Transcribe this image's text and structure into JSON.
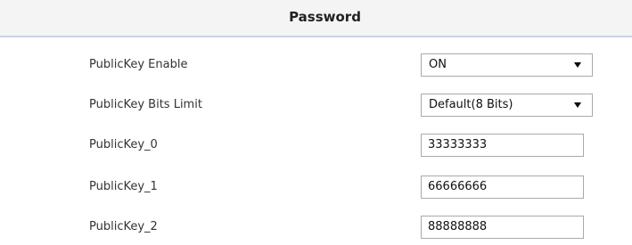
{
  "section": {
    "title": "Password"
  },
  "fields": {
    "publickey_enable": {
      "label": "PublicKey Enable",
      "value": "ON"
    },
    "publickey_bits_limit": {
      "label": "PublicKey Bits Limit",
      "value": "Default(8 Bits)"
    },
    "publickey_0": {
      "label": "PublicKey_0",
      "value": "33333333"
    },
    "publickey_1": {
      "label": "PublicKey_1",
      "value": "66666666"
    },
    "publickey_2": {
      "label": "PublicKey_2",
      "value": "88888888"
    }
  },
  "icons": {
    "dropdown": "chevron-down-icon"
  }
}
